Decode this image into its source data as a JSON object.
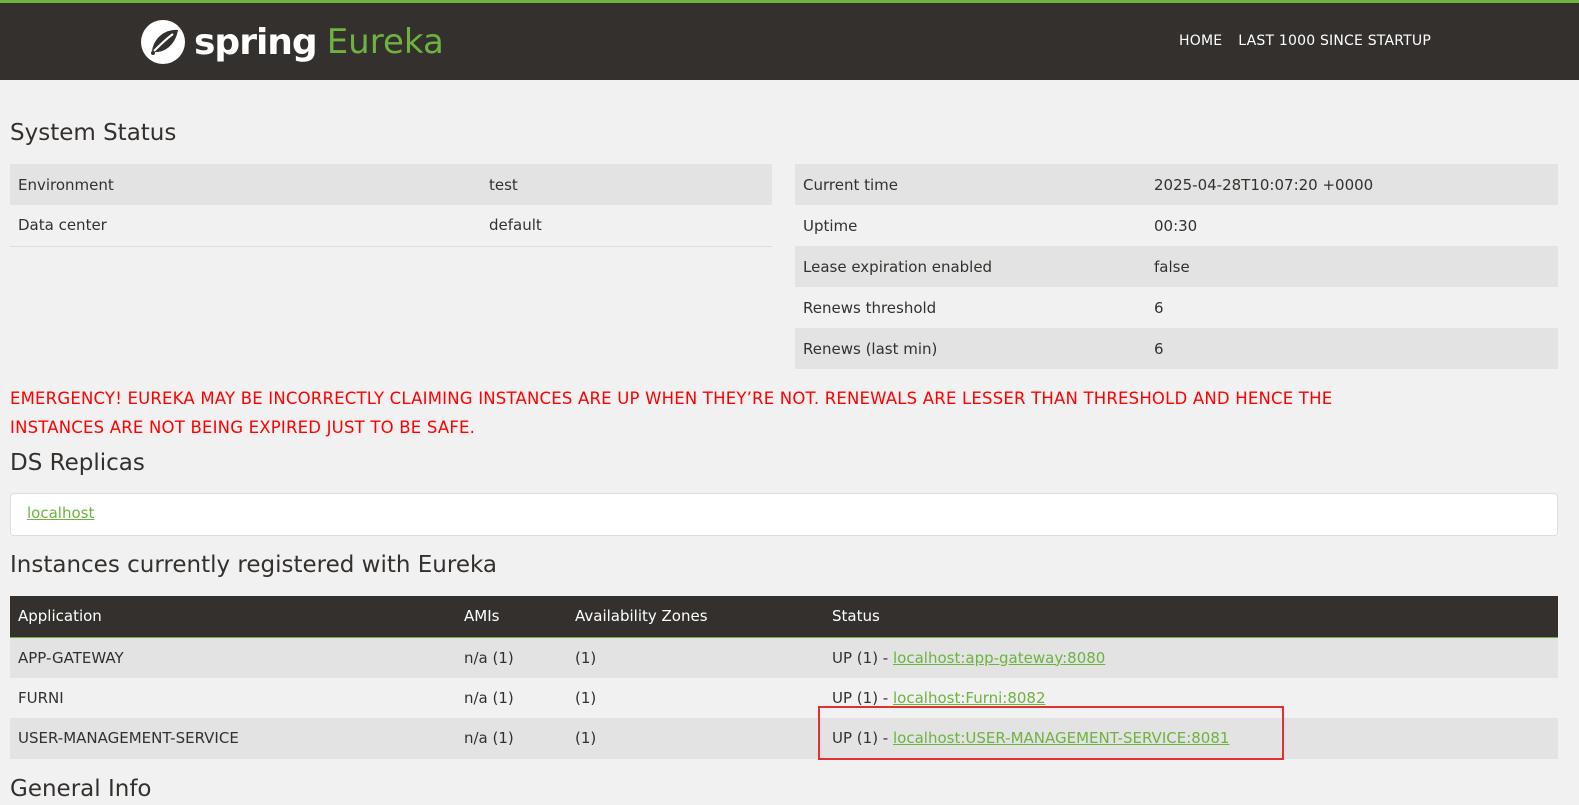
{
  "header": {
    "brand_spring": "spring",
    "brand_eureka": "Eureka",
    "nav": [
      "HOME",
      "LAST 1000 SINCE STARTUP"
    ]
  },
  "system_status": {
    "title": "System Status",
    "left": [
      {
        "label": "Environment",
        "value": "test"
      },
      {
        "label": "Data center",
        "value": "default"
      }
    ],
    "right": [
      {
        "label": "Current time",
        "value": "2025-04-28T10:07:20 +0000"
      },
      {
        "label": "Uptime",
        "value": "00:30"
      },
      {
        "label": "Lease expiration enabled",
        "value": "false"
      },
      {
        "label": "Renews threshold",
        "value": "6"
      },
      {
        "label": "Renews (last min)",
        "value": "6"
      }
    ]
  },
  "emergency": {
    "line1": "EMERGENCY! EUREKA MAY BE INCORRECTLY CLAIMING INSTANCES ARE UP WHEN THEY’RE NOT. RENEWALS ARE LESSER THAN THRESHOLD AND HENCE THE",
    "line2": "INSTANCES ARE NOT BEING EXPIRED JUST TO BE SAFE."
  },
  "replicas": {
    "title": "DS Replicas",
    "link": "localhost"
  },
  "instances": {
    "title": "Instances currently registered with Eureka",
    "columns": [
      "Application",
      "AMIs",
      "Availability Zones",
      "Status"
    ],
    "rows": [
      {
        "app": "APP-GATEWAY",
        "amis": "n/a (1)",
        "zones": "(1)",
        "status": "UP (1) - ",
        "link": "localhost:app-gateway:8080"
      },
      {
        "app": "FURNI",
        "amis": "n/a (1)",
        "zones": "(1)",
        "status": "UP (1) - ",
        "link": "localhost:Furni:8082"
      },
      {
        "app": "USER-MANAGEMENT-SERVICE",
        "amis": "n/a (1)",
        "zones": "(1)",
        "status": "UP (1) - ",
        "link": "localhost:USER-MANAGEMENT-SERVICE:8081"
      }
    ]
  },
  "general_info": {
    "title": "General Info"
  },
  "colors": {
    "brand_green": "#6db33f",
    "header_dark": "#34302d",
    "emergency_red": "#ff0000",
    "highlight_red": "#e03131"
  }
}
